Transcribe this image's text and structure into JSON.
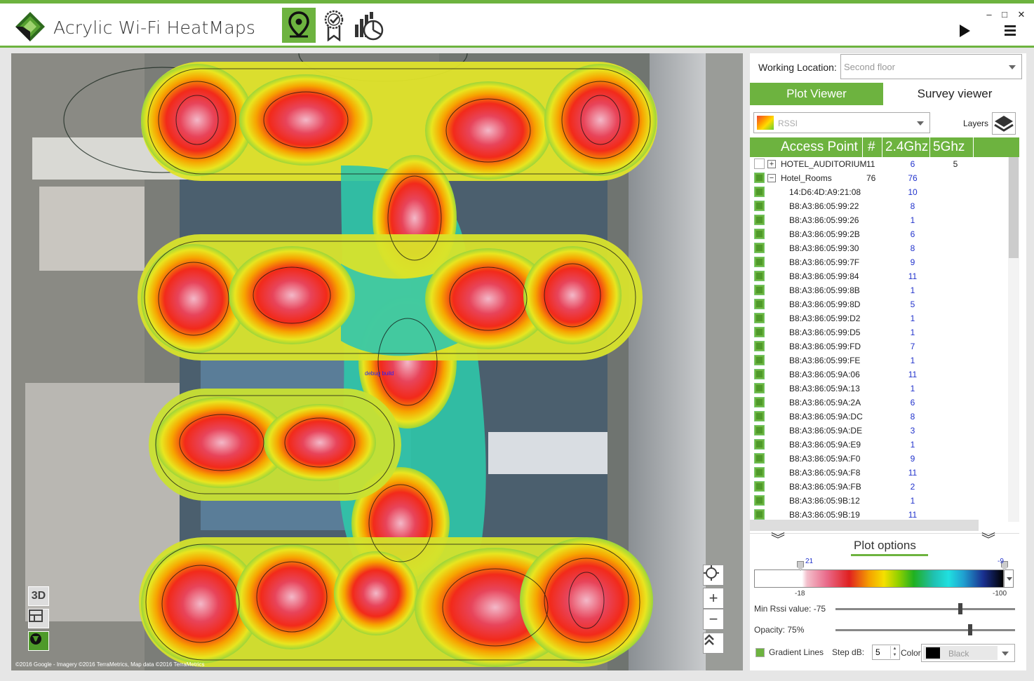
{
  "app": {
    "title": "Acrylic Wi-Fi HeatMaps",
    "accent_color": "#6db33f",
    "modes": [
      {
        "icon": "map-pin-icon",
        "active": true
      },
      {
        "icon": "certificate-icon",
        "active": false
      },
      {
        "icon": "report-chart-icon",
        "active": false
      }
    ],
    "window_controls": {
      "minimize": "–",
      "maximize": "□",
      "close": "✕"
    }
  },
  "map": {
    "copyright": "©2016 Google - Imagery ©2016 TerraMetrics, Map data ©2016 TerraMetrics",
    "debug_label": "debug build",
    "view_controls": {
      "three_d": "3D"
    },
    "zoom_in": "+",
    "zoom_out": "−"
  },
  "panel": {
    "working_location_label": "Working Location:",
    "working_location_value": "Second floor",
    "tabs": [
      "Plot Viewer",
      "Survey viewer"
    ],
    "metric_value": "RSSI",
    "layers_label": "Layers",
    "table": {
      "headers": [
        "Access Point",
        "#",
        "2.4Ghz",
        "5Ghz"
      ],
      "rows": [
        {
          "name": "HOTEL_AUDITORIUM",
          "count": "11",
          "g24": "6",
          "g5": "5",
          "level": 0,
          "checked": false,
          "expander": "+"
        },
        {
          "name": "Hotel_Rooms",
          "count": "76",
          "g24": "76",
          "g5": "",
          "level": 0,
          "checked": true,
          "expander": "−"
        },
        {
          "name": "14:D6:4D:A9:21:08",
          "count": "",
          "g24": "10",
          "g5": "",
          "level": 1,
          "checked": true,
          "expander": ""
        },
        {
          "name": "B8:A3:86:05:99:22",
          "count": "",
          "g24": "8",
          "g5": "",
          "level": 1,
          "checked": true,
          "expander": ""
        },
        {
          "name": "B8:A3:86:05:99:26",
          "count": "",
          "g24": "1",
          "g5": "",
          "level": 1,
          "checked": true,
          "expander": ""
        },
        {
          "name": "B8:A3:86:05:99:2B",
          "count": "",
          "g24": "6",
          "g5": "",
          "level": 1,
          "checked": true,
          "expander": ""
        },
        {
          "name": "B8:A3:86:05:99:30",
          "count": "",
          "g24": "8",
          "g5": "",
          "level": 1,
          "checked": true,
          "expander": ""
        },
        {
          "name": "B8:A3:86:05:99:7F",
          "count": "",
          "g24": "9",
          "g5": "",
          "level": 1,
          "checked": true,
          "expander": ""
        },
        {
          "name": "B8:A3:86:05:99:84",
          "count": "",
          "g24": "11",
          "g5": "",
          "level": 1,
          "checked": true,
          "expander": ""
        },
        {
          "name": "B8:A3:86:05:99:8B",
          "count": "",
          "g24": "1",
          "g5": "",
          "level": 1,
          "checked": true,
          "expander": ""
        },
        {
          "name": "B8:A3:86:05:99:8D",
          "count": "",
          "g24": "5",
          "g5": "",
          "level": 1,
          "checked": true,
          "expander": ""
        },
        {
          "name": "B8:A3:86:05:99:D2",
          "count": "",
          "g24": "1",
          "g5": "",
          "level": 1,
          "checked": true,
          "expander": ""
        },
        {
          "name": "B8:A3:86:05:99:D5",
          "count": "",
          "g24": "1",
          "g5": "",
          "level": 1,
          "checked": true,
          "expander": ""
        },
        {
          "name": "B8:A3:86:05:99:FD",
          "count": "",
          "g24": "7",
          "g5": "",
          "level": 1,
          "checked": true,
          "expander": ""
        },
        {
          "name": "B8:A3:86:05:99:FE",
          "count": "",
          "g24": "1",
          "g5": "",
          "level": 1,
          "checked": true,
          "expander": ""
        },
        {
          "name": "B8:A3:86:05:9A:06",
          "count": "",
          "g24": "11",
          "g5": "",
          "level": 1,
          "checked": true,
          "expander": ""
        },
        {
          "name": "B8:A3:86:05:9A:13",
          "count": "",
          "g24": "1",
          "g5": "",
          "level": 1,
          "checked": true,
          "expander": ""
        },
        {
          "name": "B8:A3:86:05:9A:2A",
          "count": "",
          "g24": "6",
          "g5": "",
          "level": 1,
          "checked": true,
          "expander": ""
        },
        {
          "name": "B8:A3:86:05:9A:DC",
          "count": "",
          "g24": "8",
          "g5": "",
          "level": 1,
          "checked": true,
          "expander": ""
        },
        {
          "name": "B8:A3:86:05:9A:DE",
          "count": "",
          "g24": "3",
          "g5": "",
          "level": 1,
          "checked": true,
          "expander": ""
        },
        {
          "name": "B8:A3:86:05:9A:E9",
          "count": "",
          "g24": "1",
          "g5": "",
          "level": 1,
          "checked": true,
          "expander": ""
        },
        {
          "name": "B8:A3:86:05:9A:F0",
          "count": "",
          "g24": "9",
          "g5": "",
          "level": 1,
          "checked": true,
          "expander": ""
        },
        {
          "name": "B8:A3:86:05:9A:F8",
          "count": "",
          "g24": "11",
          "g5": "",
          "level": 1,
          "checked": true,
          "expander": ""
        },
        {
          "name": "B8:A3:86:05:9A:FB",
          "count": "",
          "g24": "2",
          "g5": "",
          "level": 1,
          "checked": true,
          "expander": ""
        },
        {
          "name": "B8:A3:86:05:9B:12",
          "count": "",
          "g24": "1",
          "g5": "",
          "level": 1,
          "checked": true,
          "expander": ""
        },
        {
          "name": "B8:A3:86:05:9B:19",
          "count": "",
          "g24": "11",
          "g5": "",
          "level": 1,
          "checked": true,
          "expander": ""
        }
      ]
    },
    "plot_options": {
      "title": "Plot options",
      "gradient": {
        "marker_left_value": "21",
        "marker_right_value": "-9",
        "min_label": "-18",
        "max_label": "-100"
      },
      "min_rssi_label": "Min Rssi value: -75",
      "min_rssi_value": -75,
      "opacity_label": "Opacity: 75%",
      "opacity_value": 75,
      "gradient_lines_label": "Gradient Lines",
      "gradient_lines_checked": true,
      "step_label": "Step dB:",
      "step_value": "5",
      "color_label": "Color:",
      "color_value": "Black"
    }
  }
}
